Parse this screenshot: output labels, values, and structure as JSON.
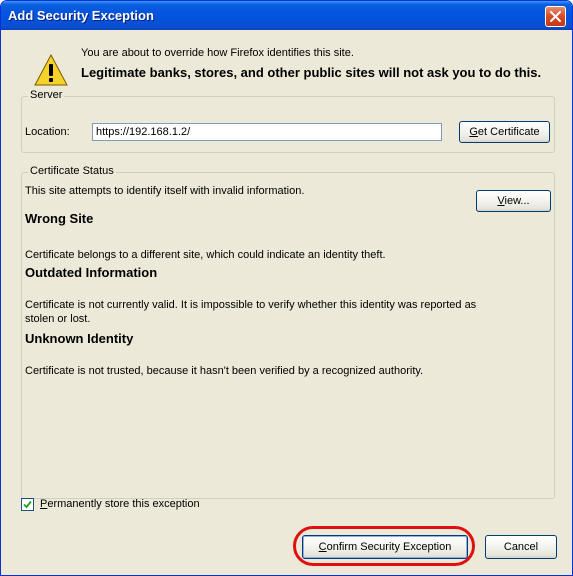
{
  "window": {
    "title": "Add Security Exception"
  },
  "intro": {
    "line1": "You are about to override how Firefox identifies this site.",
    "line2": "Legitimate banks, stores, and other public sites will not ask you to do this."
  },
  "server": {
    "legend": "Server",
    "location_label": "Location:",
    "location_value": "https://192.168.1.2/",
    "get_certificate_accel": "G",
    "get_certificate_rest": "et Certificate"
  },
  "status": {
    "legend": "Certificate Status",
    "line": "This site attempts to identify itself with invalid information.",
    "view_accel": "V",
    "view_rest": "iew...",
    "wrong_site": {
      "heading": "Wrong Site",
      "text": "Certificate belongs to a different site, which could indicate an identity theft."
    },
    "outdated": {
      "heading": "Outdated Information",
      "text_line1": "Certificate is not currently valid. It is impossible to verify whether this identity was reported as",
      "text_line2": "stolen or lost."
    },
    "unknown": {
      "heading": "Unknown Identity",
      "text": "Certificate is not trusted, because it hasn't been verified by a recognized authority."
    }
  },
  "permanent": {
    "checked": true,
    "label_accel": "P",
    "label_rest": "ermanently store this exception"
  },
  "buttons": {
    "confirm_accel": "C",
    "confirm_rest": "onfirm Security Exception",
    "cancel": "Cancel"
  },
  "colors": {
    "titlebar": "#0454e2",
    "highlight": "#e01010",
    "dialog_bg": "#ece9d8"
  }
}
